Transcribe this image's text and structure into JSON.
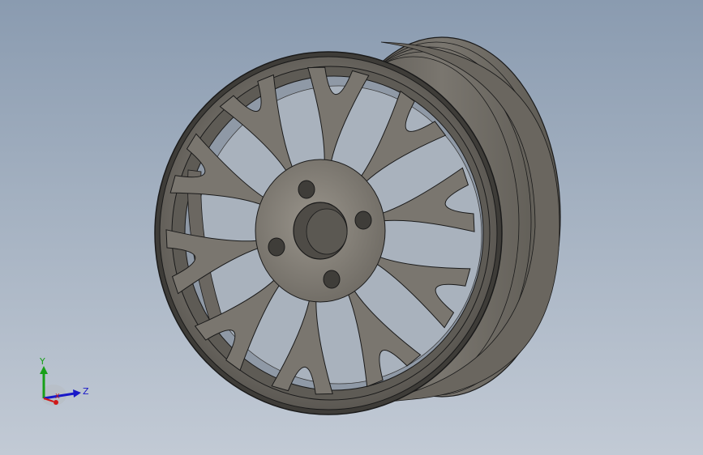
{
  "viewport": {
    "background_top": "#8a9bb0",
    "background_bottom": "#c2cad5"
  },
  "model": {
    "kind": "wheel-rim",
    "spoke_pairs": 10,
    "lug_holes": 4,
    "surface_color": "#7a766f",
    "edge_color": "#1a1a1a"
  },
  "triad": {
    "y_label": "Y",
    "z_label": "Z",
    "x_label": "X",
    "y_color": "#18a018",
    "z_color": "#1818c8",
    "x_color": "#d01818"
  }
}
